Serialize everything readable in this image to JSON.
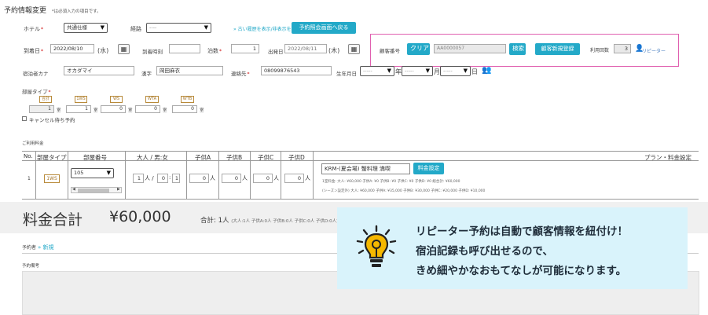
{
  "page": {
    "title": "予約情報変更",
    "required_note": "*は必須入力の項目です。"
  },
  "row1": {
    "hotel_label": "ホテル",
    "hotel_value": "共通仕様",
    "route_label": "経路",
    "route_value": "----",
    "history_link": "» 古い履歴を表示/非表示を開く",
    "back_button": "予約照会画面へ戻る"
  },
  "row2": {
    "checkin_label": "到着日",
    "checkin_value": "2022/08/10",
    "checkin_dow": "(水)",
    "arrival_time_label": "到着時刻",
    "nights_label": "泊数",
    "nights_value": "1",
    "checkout_label": "出発日",
    "checkout_value": "2022/08/11",
    "checkout_dow": "(木)"
  },
  "customer": {
    "id_label": "顧客番号",
    "clear_button": "クリア",
    "id_value": "AA0000057",
    "search_button": "検索",
    "register_button": "顧客新規登録",
    "visits_label": "利用回数",
    "visits_value": "3",
    "repeater_label": "リピーター"
  },
  "guest": {
    "kana_label": "宿泊者カナ",
    "kana_value": "オカダマイ",
    "kanji_label": "漢字",
    "kanji_value": "岡田麻衣",
    "contact_label": "連絡先",
    "contact_value": "08099876543",
    "birthday_label": "生年月日",
    "year_value": "-----",
    "year_suffix": "年",
    "month_value": "-----",
    "month_suffix": "月",
    "day_value": "-----",
    "day_suffix": "日"
  },
  "room_type": {
    "label": "部屋タイプ",
    "types": [
      {
        "code": "合計",
        "count": "1",
        "unit": "室"
      },
      {
        "code": "1WS",
        "count": "1",
        "unit": "室"
      },
      {
        "code": "WS",
        "count": "0",
        "unit": "室"
      },
      {
        "code": "WTA",
        "count": "0",
        "unit": "室"
      },
      {
        "code": "WTB",
        "count": "0",
        "unit": "室"
      }
    ],
    "cancel_wait_label": "キャンセル待ち予約"
  },
  "usage": {
    "section_label": "ご利用料金",
    "headers": [
      "No.",
      "部屋タイプ",
      "部屋番号",
      "大人 / 男:女",
      "子供A",
      "子供B",
      "子供C",
      "子供D",
      "プラン・料金設定"
    ],
    "row": {
      "no": "1",
      "room_type": "1WS",
      "room_no": "105",
      "adults": "1",
      "adults_unit": "人 /",
      "male": "0",
      "female": "1",
      "child_a": "0",
      "child_b": "0",
      "child_c": "0",
      "child_d": "0",
      "child_unit": "人",
      "plan_name": "KRM-(夏会場) 蟹料理 満喫",
      "plan_button": "料金設定",
      "detail1": "1室料金: 大人: ¥60,000 子供A: ¥0 子供B: ¥0 子供C: ¥0 子供D: ¥0 総合計: ¥60,000",
      "detail2": "(シーズン設定外) 大人: ¥60,000 子供A: ¥35,000 子供B: ¥30,000 子供C: ¥20,000 子供D: ¥10,000"
    }
  },
  "total": {
    "label": "料金合計",
    "amount": "¥60,000",
    "summary_label": "合計: 1人",
    "summary_detail": "(大人:1人 子供A:0人 子供B:0人 子供C:0人 子供D:0人)"
  },
  "booker": {
    "label": "予約者",
    "link": "» 新規"
  },
  "remarks": {
    "label": "予約備考"
  },
  "callout": {
    "line1": "リピーター予約は自動で顧客情報を紐付け！",
    "line2": "宿泊記録も呼び出せるので、",
    "line3": "きめ細やかなおもてなしが可能になります。"
  },
  "colors": {
    "accent": "#23a9c8",
    "highlight_border": "#e060b0",
    "callout_bg": "#d9f3fb",
    "bulb": "#f5b800"
  }
}
